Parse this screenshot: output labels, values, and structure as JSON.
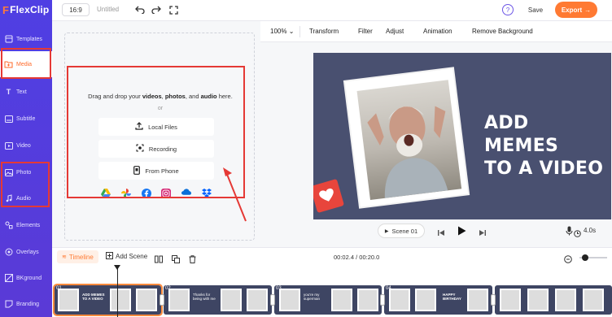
{
  "app": {
    "logo_text": "FlexClip",
    "title": "Untitled",
    "ratio": "16:9"
  },
  "header": {
    "save_label": "Save",
    "export_label": "Export",
    "help_label": "?"
  },
  "sidebar": {
    "items": [
      {
        "label": "Templates",
        "icon": "templates-icon"
      },
      {
        "label": "Media",
        "icon": "media-folder-icon",
        "active": true
      },
      {
        "label": "Text",
        "icon": "text-icon"
      },
      {
        "label": "Subtitle",
        "icon": "subtitle-icon"
      },
      {
        "label": "Video",
        "icon": "video-icon"
      },
      {
        "label": "Photo",
        "icon": "photo-icon"
      },
      {
        "label": "Audio",
        "icon": "audio-icon"
      },
      {
        "label": "Elements",
        "icon": "elements-icon"
      },
      {
        "label": "Overlays",
        "icon": "overlays-icon"
      },
      {
        "label": "BKground",
        "icon": "background-icon"
      },
      {
        "label": "Branding",
        "icon": "branding-icon"
      }
    ]
  },
  "media_panel": {
    "drop_prefix": "Drag and drop your",
    "drop_videos": "videos",
    "drop_photos": "photos",
    "drop_and": ", and",
    "drop_audio": "audio",
    "drop_suffix": "here.",
    "or": "or",
    "local_files": "Local Files",
    "recording": "Recording",
    "from_phone": "From Phone",
    "cloud_sources": [
      "google-drive-icon",
      "google-photos-icon",
      "facebook-icon",
      "instagram-icon",
      "onedrive-icon",
      "dropbox-icon"
    ]
  },
  "toolbar": {
    "zoom": "100%",
    "transform": "Transform",
    "filter": "Filter",
    "adjust": "Adjust",
    "animation": "Animation",
    "remove_background": "Remove Background"
  },
  "canvas": {
    "headline_line1": "ADD MEMES",
    "headline_line2": "TO A VIDEO"
  },
  "player": {
    "scene_label": "Scene 01",
    "speed": "4.0s"
  },
  "timeline": {
    "label": "Timeline",
    "add_scene": "Add Scene",
    "time": "00:02.4 / 00:20.0",
    "clips": [
      {
        "num": "01",
        "text1": "ADD MEMES",
        "text2": "TO A VIDEO"
      },
      {
        "num": "02",
        "text1": "Thanks for",
        "text2": "being with me"
      },
      {
        "num": "03",
        "text1": "you're my",
        "text2": "superman"
      },
      {
        "num": "04",
        "text1": "HAPPY",
        "text2": "BIRTHDAY"
      }
    ]
  },
  "colors": {
    "accent": "#ff7a33",
    "sidebar": "#5040e0",
    "highlight": "#e53935"
  }
}
